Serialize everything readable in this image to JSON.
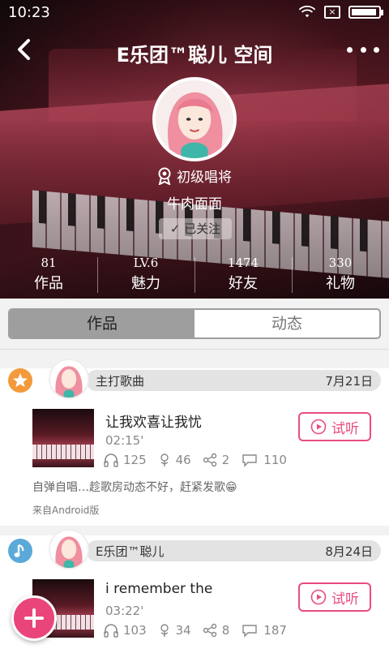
{
  "status_bar": {
    "time": "10:23",
    "sim_label": "×"
  },
  "nav": {
    "title": "E乐团™聪儿 空间"
  },
  "profile": {
    "level_title": "初级唱将",
    "nickname": "牛肉面面",
    "follow_label": "已关注"
  },
  "stats": [
    {
      "value": "81",
      "label": "作品"
    },
    {
      "value": "LV.6",
      "label": "魅力"
    },
    {
      "value": "1474",
      "label": "好友"
    },
    {
      "value": "330",
      "label": "礼物"
    }
  ],
  "tabs": [
    {
      "label": "作品",
      "active": true
    },
    {
      "label": "动态",
      "active": false
    }
  ],
  "feed": [
    {
      "badge_icon": "star-icon",
      "label": "主打歌曲",
      "date": "7月21日",
      "song_title": "让我欢喜让我忧",
      "duration": "02:15'",
      "listens": "125",
      "flowers": "46",
      "shares": "2",
      "comments": "110",
      "listen_label": "试听",
      "text": "自弹自唱…趁歌房动态不好，赶紧发歌😁",
      "source": "来自Android版"
    },
    {
      "badge_icon": "music-note-icon",
      "label": "E乐团™聪儿",
      "date": "8月24日",
      "song_title": "i remember the",
      "duration": "03:22'",
      "listens": "103",
      "flowers": "34",
      "shares": "8",
      "comments": "187",
      "listen_label": "试听"
    }
  ],
  "colors": {
    "accent": "#e9457a",
    "tab_active": "#9e9e9e",
    "badge_star": "#f39a3a",
    "badge_music": "#5aa9d8"
  }
}
